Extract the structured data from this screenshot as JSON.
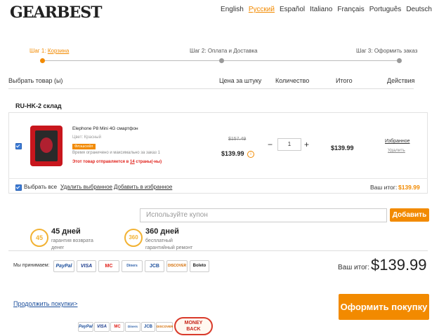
{
  "logo": "GEARBEST",
  "languages": [
    {
      "label": "English",
      "active": false
    },
    {
      "label": "Русский",
      "active": true
    },
    {
      "label": "Español",
      "active": false
    },
    {
      "label": "Italiano",
      "active": false
    },
    {
      "label": "Français",
      "active": false
    },
    {
      "label": "Português",
      "active": false
    },
    {
      "label": "Deutsch",
      "active": false
    }
  ],
  "steps": {
    "step1_prefix": "Шаг 1: ",
    "step1_link": "Корзина",
    "step2": "Шаг 2: Оплата и Доставка",
    "step3": "Шаг 3: Оформить заказ"
  },
  "table_header": {
    "select": "Выбрать товар (ы)",
    "unit_price": "Цена за штуку",
    "quantity": "Количество",
    "total": "Итого",
    "actions": "Действия"
  },
  "warehouse": "RU-HK-2 склад",
  "item": {
    "name": "Elephone P8 Mini 4G смартфон",
    "color": "Цвет: Красный",
    "flash_badge": "Флэшсейл",
    "limit_note": "Время ограничено и максимально за заказ 1",
    "ship_prefix": "Этот товар отправляется в ",
    "ship_count": "14",
    "ship_suffix": " страны(-ны)",
    "old_price": "$157.49",
    "price": "$139.99",
    "qty": "1",
    "minus": "−",
    "plus": "+",
    "subtotal": "$139.99",
    "favorite": "Избранное",
    "delete": "Удалить"
  },
  "cart_footer": {
    "select_all": "Выбрать все",
    "delete_selected": "Удалить выбранное",
    "add_to_favorites": "Добавить в избранное",
    "total_label": "Ваш итог:",
    "total_value": "$139.99"
  },
  "coupon": {
    "placeholder": "Используйте купон",
    "button": "Добавить"
  },
  "guarantees": [
    {
      "badge": "45",
      "title": "45 дней",
      "line1": "гарантия возврата",
      "line2": "денег"
    },
    {
      "badge": "360",
      "title": "360 дней",
      "line1": "бесплатный",
      "line2": "гарантийный ремонт"
    }
  ],
  "payments": {
    "label": "Мы принимаем:",
    "methods": [
      "PayPal",
      "VISA",
      "MC",
      "Diners",
      "JCB",
      "DISCOVER",
      "Boleto"
    ]
  },
  "order_total": {
    "label": "Ваш итог:",
    "value": "$139.99"
  },
  "continue_link": "Продолжить покупки>",
  "checkout_button": "Оформить покупку",
  "bottom_badges": [
    "PayPal",
    "VISA",
    "MC",
    "Diners",
    "JCB",
    "DISCOVER"
  ],
  "money_back": {
    "line1": "MONEY",
    "line2": "BACK"
  },
  "colors": {
    "accent": "#f28a00",
    "link": "#1b4e9b",
    "alert": "#e0201a"
  }
}
